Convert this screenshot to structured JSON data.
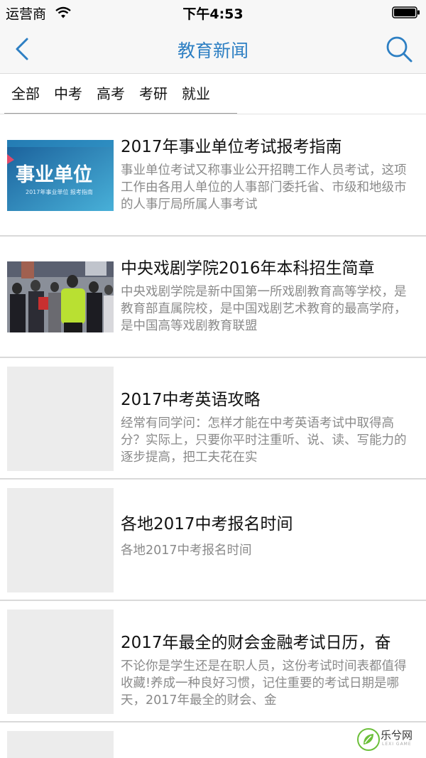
{
  "status_bar": {
    "carrier": "运营商",
    "time": "下午4:53"
  },
  "nav": {
    "title": "教育新闻",
    "accent_color": "#2d7fc3"
  },
  "tabs": [
    {
      "label": "全部"
    },
    {
      "label": "中考"
    },
    {
      "label": "高考"
    },
    {
      "label": "考研"
    },
    {
      "label": "就业"
    }
  ],
  "news": [
    {
      "title": "2017年事业单位考试报考指南",
      "summary": "事业单位考试又称事业公开招聘工作人员考试，这项工作由各用人单位的人事部门委托省、市级和地级市的人事厅局所属人事考试",
      "thumb_text": "事业单位",
      "thumb_subtext": "2017年事业单位 报考指南"
    },
    {
      "title": "中央戏剧学院2016年本科招生简章",
      "summary": "中央戏剧学院是新中国第一所戏剧教育高等学校，是教育部直属院校，是中国戏剧艺术教育的最高学府，是中国高等戏剧教育联盟"
    },
    {
      "title": "2017中考英语攻略",
      "summary": "经常有同学问：怎样才能在中考英语考试中取得高分？实际上，只要你平时注重听、说、读、写能力的逐步提高，把工夫花在实"
    },
    {
      "title": "各地2017中考报名时间",
      "summary": "各地2017中考报名时间"
    },
    {
      "title": "2017年最全的财会金融考试日历，奋",
      "summary": "不论你是学生还是在职人员，这份考试时间表都值得收藏!养成一种良好习惯，记住重要的考试日期是哪天，2017年最全的财会、金"
    }
  ],
  "watermark": {
    "text": "乐兮网",
    "sub": "LEXI GAME"
  }
}
